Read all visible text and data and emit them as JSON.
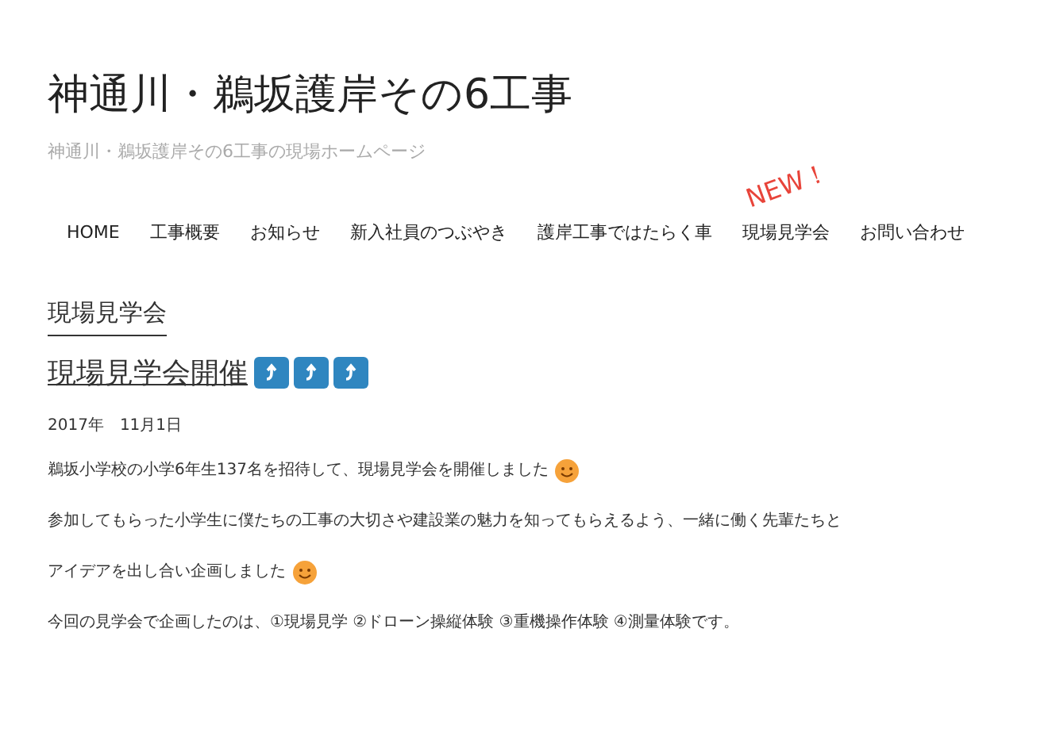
{
  "site": {
    "title": "神通川・鵜坂護岸その6工事",
    "tagline": "神通川・鵜坂護岸その6工事の現場ホームページ"
  },
  "nav": [
    {
      "label": "HOME"
    },
    {
      "label": "工事概要"
    },
    {
      "label": "お知らせ"
    },
    {
      "label": "新入社員のつぶやき"
    },
    {
      "label": "護岸工事ではたらく車"
    },
    {
      "label": "現場見学会",
      "badge": "NEW！"
    },
    {
      "label": "お問い合わせ"
    }
  ],
  "section_title": "現場見学会",
  "post": {
    "title": "現場見学会開催",
    "share_buttons": [
      {
        "kind": "arrow"
      },
      {
        "kind": "arrow"
      },
      {
        "kind": "arrow"
      }
    ],
    "date": "2017年　11月1日",
    "paragraphs": [
      {
        "text": "鵜坂小学校の小学6年生137名を招待して、現場見学会を開催しました",
        "emoji": true
      },
      {
        "text": "参加してもらった小学生に僕たちの工事の大切さや建設業の魅力を知ってもらえるよう、一緒に働く先輩たちと",
        "emoji": false
      },
      {
        "text": "アイデアを出し合い企画しました",
        "emoji": true
      },
      {
        "text": "今回の見学会で企画したのは、①現場見学  ②ドローン操縦体験  ③重機操作体験  ④測量体験です。",
        "emoji": false
      }
    ]
  }
}
